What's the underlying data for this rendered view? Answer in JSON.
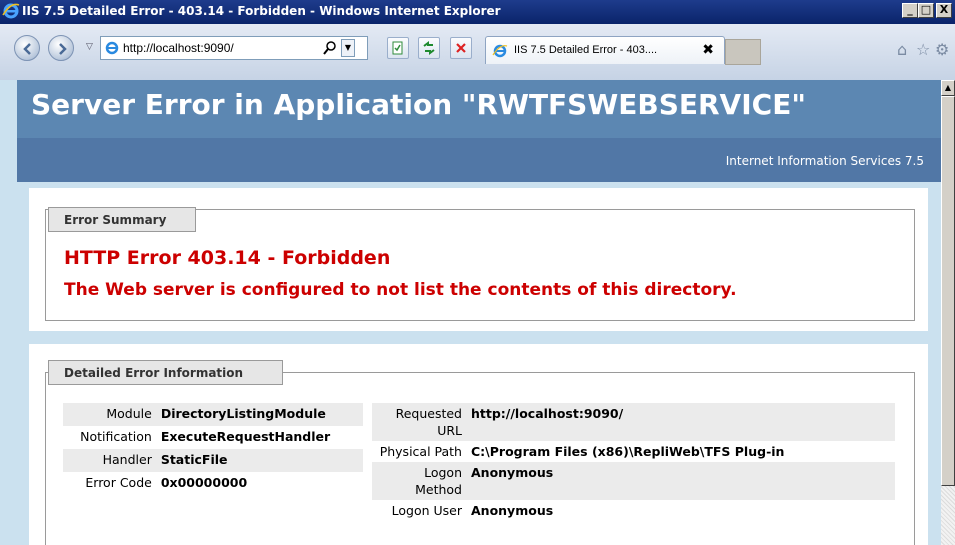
{
  "window": {
    "title": "IIS 7.5 Detailed Error - 403.14 - Forbidden - Windows Internet Explorer",
    "minimize_icon": "minimize-icon",
    "maximize_icon": "maximize-icon",
    "close_icon": "close-icon"
  },
  "toolbar": {
    "address": "http://localhost:9090/",
    "tab_label": "IIS 7.5 Detailed Error - 403....",
    "tab_close": "✖",
    "icons": [
      "back-icon",
      "forward-icon",
      "search-icon",
      "compatibility-icon",
      "refresh-icon",
      "stop-icon",
      "home-icon",
      "favorites-icon",
      "tools-icon"
    ]
  },
  "page": {
    "header_title": "Server Error in Application \"RWTFSWEBSERVICE\"",
    "server_name": "Internet Information Services 7.5",
    "summary": {
      "legend": "Error Summary",
      "heading": "HTTP Error 403.14 - Forbidden",
      "description": "The Web server is configured to not list the contents of this directory."
    },
    "details": {
      "legend": "Detailed Error Information",
      "left_rows": [
        {
          "key": "Module",
          "value": "DirectoryListingModule"
        },
        {
          "key": "Notification",
          "value": "ExecuteRequestHandler"
        },
        {
          "key": "Handler",
          "value": "StaticFile"
        },
        {
          "key": "Error Code",
          "value": "0x00000000"
        }
      ],
      "right_rows": [
        {
          "key": "Requested URL",
          "value": "http://localhost:9090/"
        },
        {
          "key": "Physical Path",
          "value": "C:\\Program Files (x86)\\RepliWeb\\TFS Plug-in"
        },
        {
          "key": "Logon Method",
          "value": "Anonymous"
        },
        {
          "key": "Logon User",
          "value": "Anonymous"
        }
      ]
    }
  },
  "colors": {
    "title_bar": "#0a246a",
    "header_blue": "#5c87b2",
    "header_blue_dark": "#5177a6",
    "page_bg": "#cbe1ef",
    "error_red": "#cc0000"
  }
}
